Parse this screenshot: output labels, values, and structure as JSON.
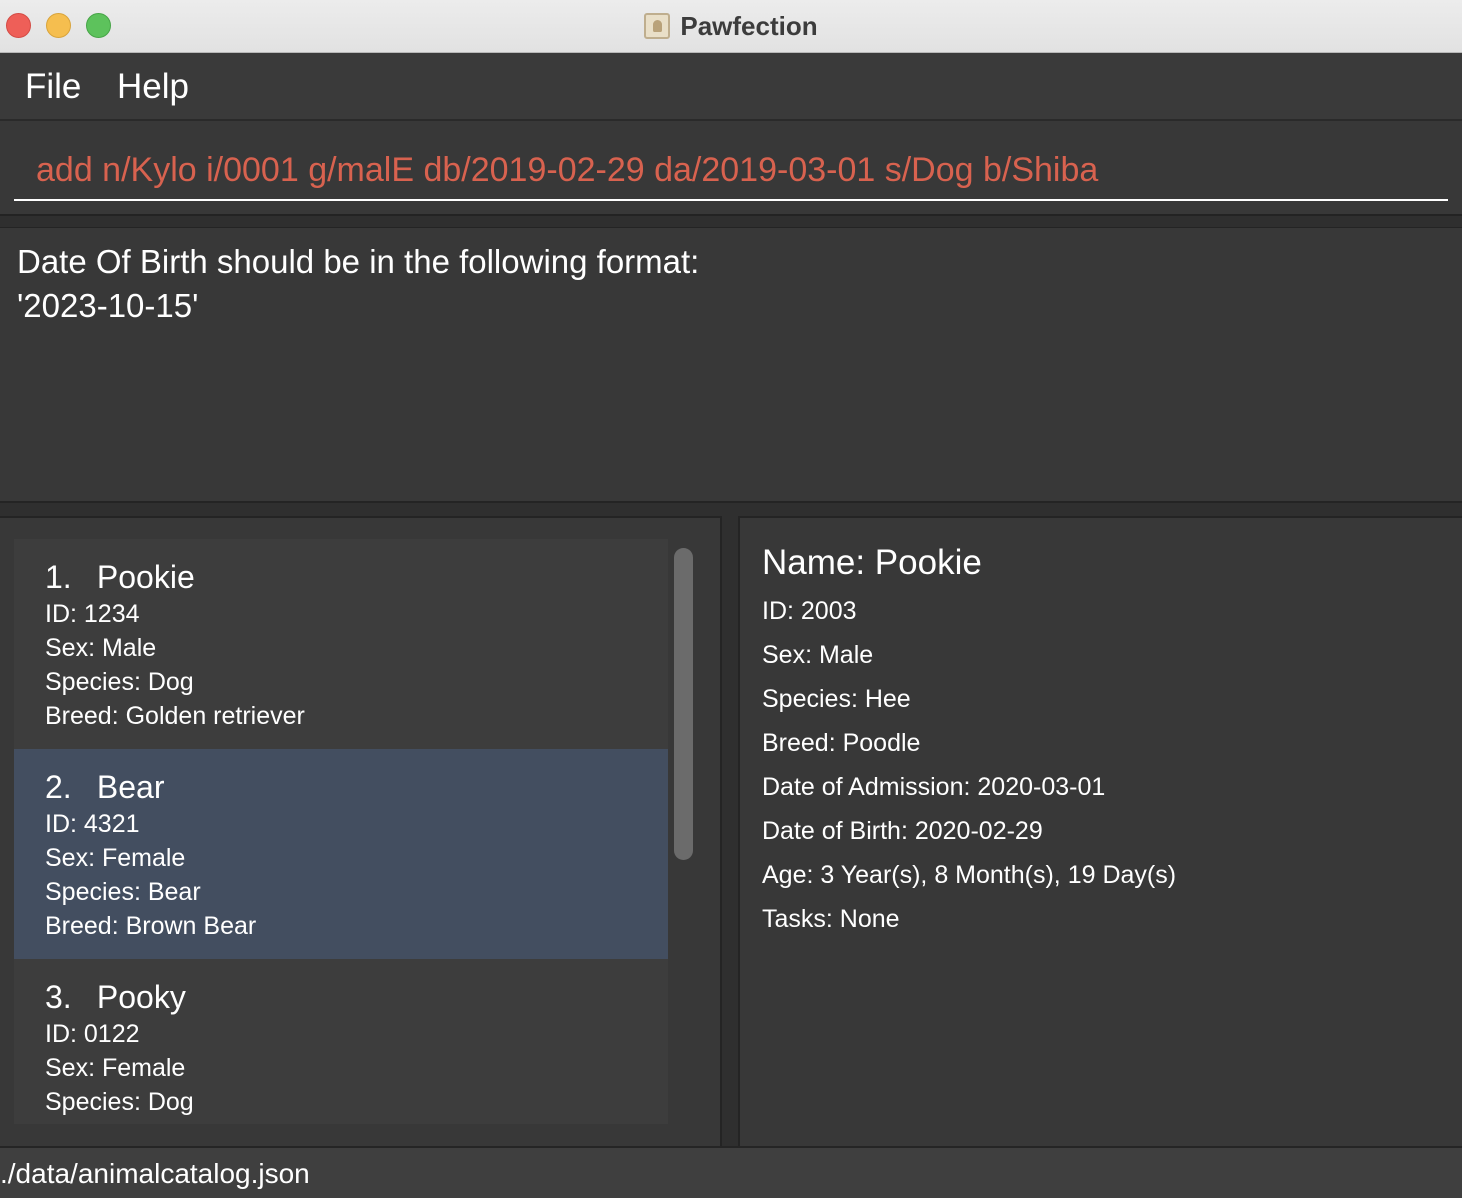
{
  "window": {
    "title": "Pawfection",
    "app_icon": "contacts-book-icon"
  },
  "menu": {
    "file_label": "File",
    "help_label": "Help"
  },
  "command": {
    "value": "add n/Kylo i/0001 g/malE db/2019-02-29 da/2019-03-01 s/Dog b/Shiba",
    "error_color": "#d8624f"
  },
  "result": {
    "message": "Date Of Birth should be in the following format:\n'2023-10-15'"
  },
  "animal_list": {
    "items": [
      {
        "index": "1.",
        "name": "Pookie",
        "id": "ID: 1234",
        "sex": "Sex: Male",
        "species": "Species: Dog",
        "breed": "Breed: Golden retriever"
      },
      {
        "index": "2.",
        "name": "Bear",
        "id": "ID: 4321",
        "sex": "Sex: Female",
        "species": "Species: Bear",
        "breed": "Breed: Brown Bear",
        "selected": true
      },
      {
        "index": "3.",
        "name": "Pooky",
        "id": "ID: 0122",
        "sex": "Sex: Female",
        "species": "Species: Dog",
        "breed": ""
      }
    ],
    "selection_color": "#434e60"
  },
  "detail": {
    "name": "Name: Pookie",
    "id": "ID: 2003",
    "sex": "Sex: Male",
    "species": "Species: Hee",
    "breed": "Breed: Poodle",
    "admission": "Date of Admission: 2020-03-01",
    "birth": "Date of Birth: 2020-02-29",
    "age": "Age: 3 Year(s), 8 Month(s), 19 Day(s)",
    "tasks": "Tasks: None"
  },
  "status": {
    "path": "./data/animalcatalog.json"
  }
}
